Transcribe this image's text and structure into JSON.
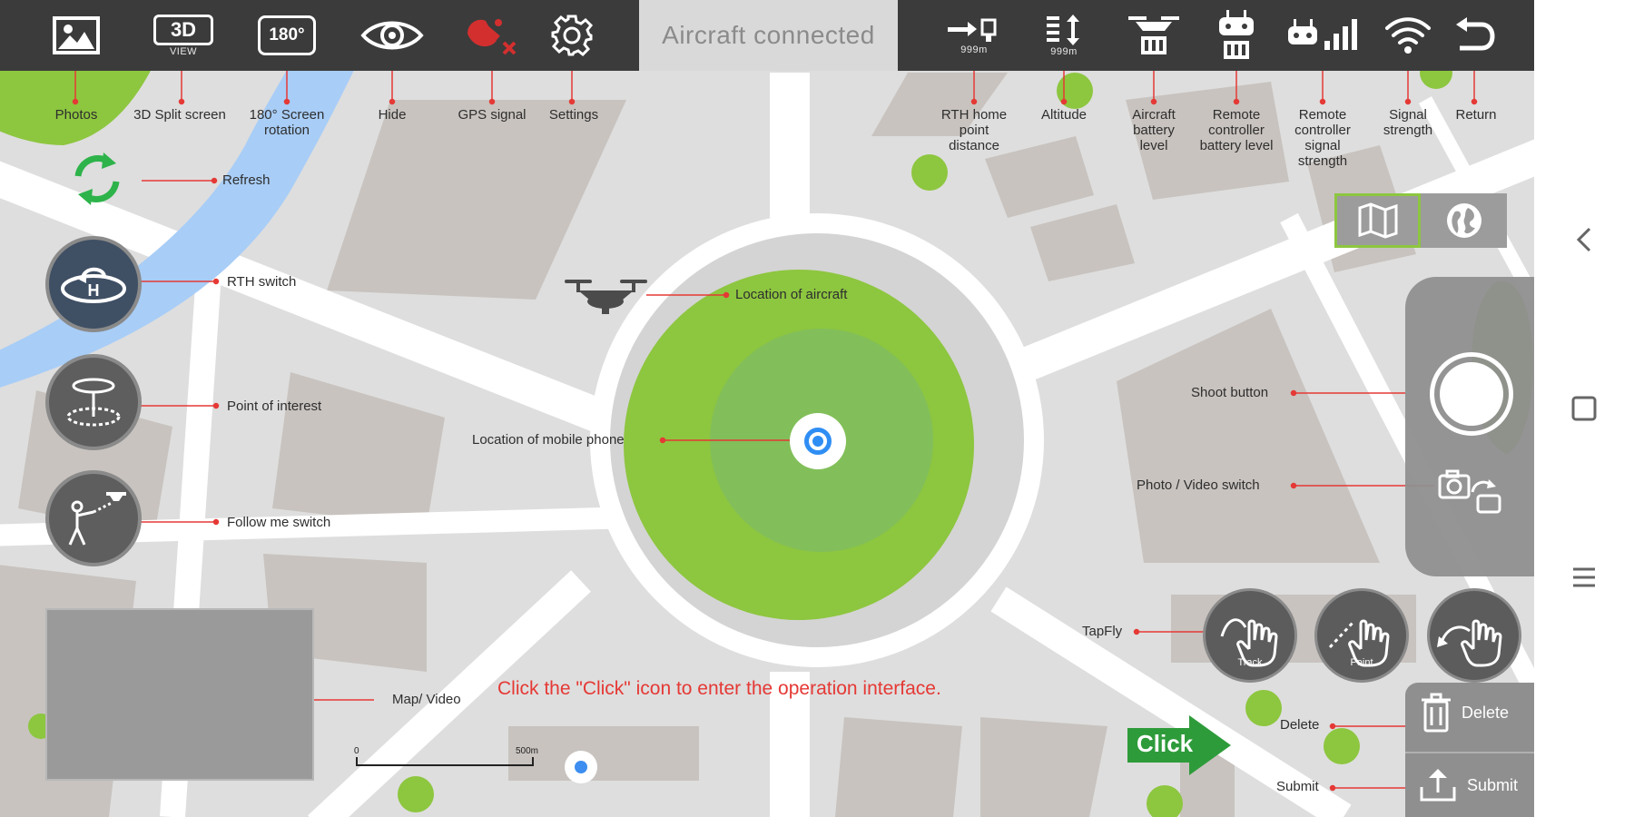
{
  "status": {
    "text": "Aircraft connected"
  },
  "toolbar": {
    "view3d_line1": "3D",
    "view3d_line2": "VIEW",
    "rotate_text": "180°",
    "rth_distance_value": "999m",
    "altitude_value": "999m"
  },
  "annotations": {
    "photos": "Photos",
    "split": "3D Split screen",
    "rotation": "180° Screen rotation",
    "hide": "Hide",
    "gps": "GPS signal",
    "settings": "Settings",
    "rth_home": "RTH home point distance",
    "altitude": "Altitude",
    "aircraft_battery": "Aircraft battery level",
    "rc_battery": "Remote controller battery level",
    "rc_signal": "Remote controller signal strength",
    "signal": "Signal strength",
    "return": "Return",
    "refresh": "Refresh",
    "rth_switch": "RTH switch",
    "poi": "Point of interest",
    "follow": "Follow me switch",
    "aircraft_location": "Location of aircraft",
    "phone_location": "Location of mobile phone",
    "shoot_button": "Shoot button",
    "photo_video_switch": "Photo / Video switch",
    "tapfly": "TapFly",
    "map_video": "Map/ Video",
    "delete": "Delete",
    "submit": "Submit",
    "instruction": "Click the  \"Click\"  icon to enter the operation interface."
  },
  "scale": {
    "start": "0",
    "end": "500m"
  },
  "tapfly_buttons": {
    "track": "Track",
    "point": "Point"
  },
  "panel": {
    "delete_label": "Delete",
    "submit_label": "Submit"
  },
  "click_arrow": {
    "label": "Click"
  },
  "icons": {
    "photos": "image-icon",
    "split": "3d-view-icon",
    "rotate": "rotate-180-icon",
    "hide": "eye-icon",
    "gps": "satellite-icon",
    "settings": "gear-icon",
    "rth_distance": "home-distance-icon",
    "altitude": "altitude-icon",
    "aircraft_battery": "drone-battery-icon",
    "rc_battery": "controller-battery-icon",
    "rc_signal": "controller-signal-icon",
    "wifi": "wifi-icon",
    "return": "return-icon",
    "refresh": "refresh-icon",
    "rth": "rth-icon",
    "poi": "poi-icon",
    "follow": "follow-me-icon",
    "map": "map-icon",
    "globe": "globe-icon",
    "camera_switch": "camera-switch-icon",
    "trash": "trash-icon",
    "upload": "upload-icon"
  },
  "colors": {
    "toolbar": "#3b3b3b",
    "status_bg": "#d9d9d9",
    "status_text": "#8b8b8b",
    "accent_green": "#8dc63f",
    "gps_red": "#d32f2f",
    "annotation_red": "#e53935",
    "water": "#a8cdf7",
    "click_green": "#2e9b3a",
    "refresh_green": "#2db34a"
  }
}
